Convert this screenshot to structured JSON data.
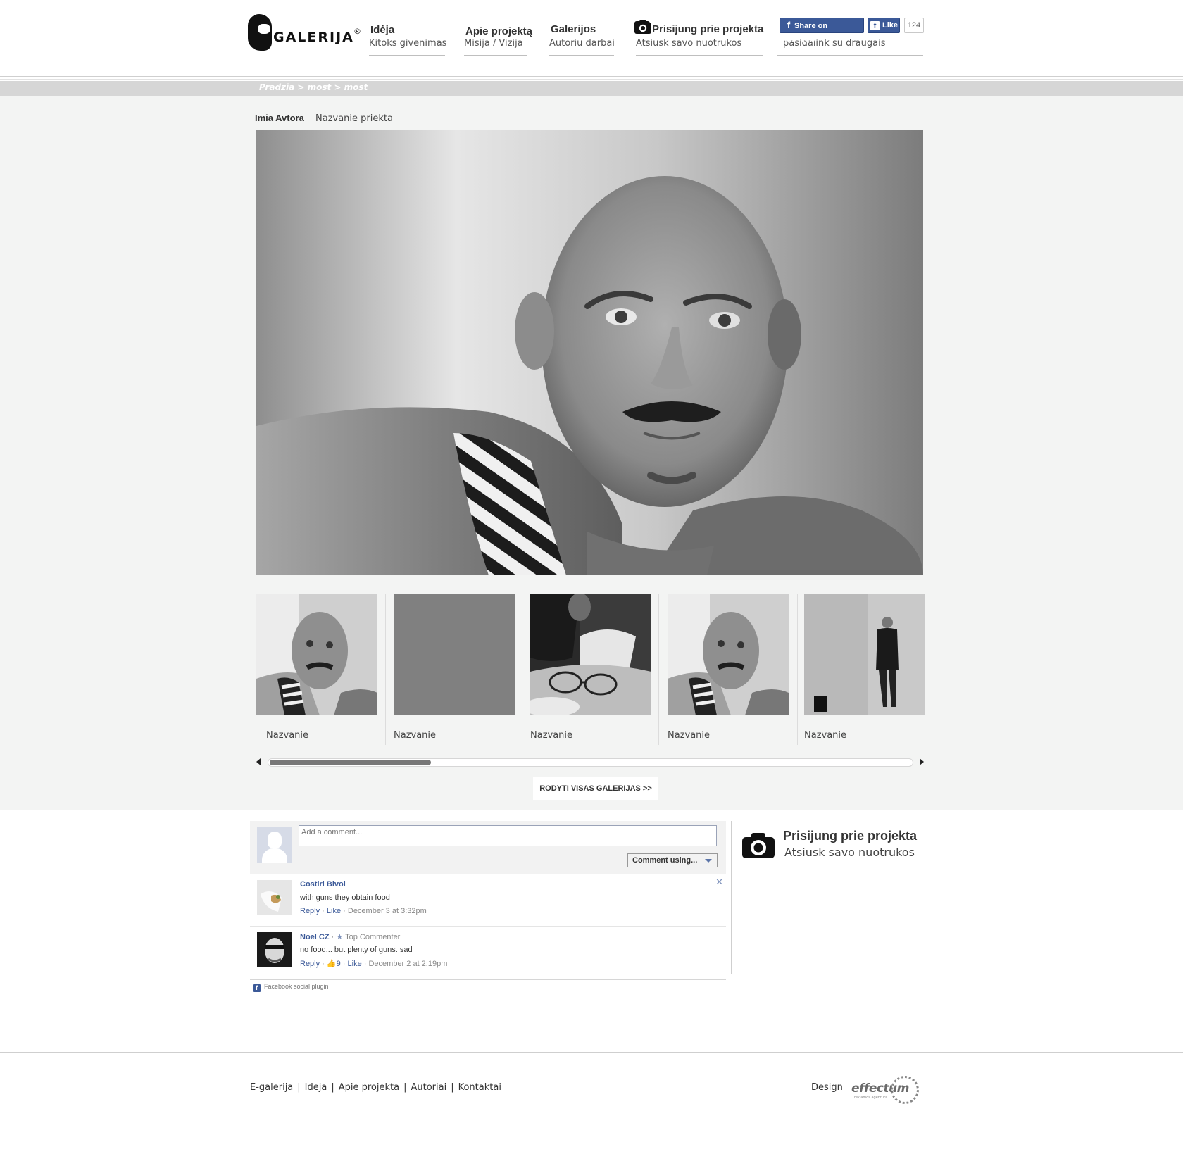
{
  "header": {
    "logo_text": "GALERIJA",
    "logo_mark": "®",
    "nav": [
      {
        "title": "Idėja",
        "sub": "Kitoks givenimas"
      },
      {
        "title": "Apie projektą",
        "sub": "Misija / Vizija"
      },
      {
        "title": "Galerijos",
        "sub": "Autoriu darbai"
      },
      {
        "title": "Prisijung prie projekta",
        "sub": "Atsiusk savo nuotrukos"
      }
    ],
    "share": {
      "share_label": "Share on Facebook",
      "like_label": "Like",
      "like_count": "124",
      "sub": "pasidalink su draugais"
    }
  },
  "breadcrumb": "Pradzia > most > most",
  "photo": {
    "author": "Imia Avtora",
    "project": "Nazvanie priekta"
  },
  "thumbnails": [
    {
      "caption": "Nazvanie",
      "kind": "portrait"
    },
    {
      "caption": "Nazvanie",
      "kind": "blank"
    },
    {
      "caption": "Nazvanie",
      "kind": "glasses"
    },
    {
      "caption": "Nazvanie",
      "kind": "portrait"
    },
    {
      "caption": "Nazvanie",
      "kind": "standing"
    }
  ],
  "scroll": {
    "position": 0.25
  },
  "show_all_label": "RODYTI VISAS GALERIJAS >>",
  "comments_widget": {
    "placeholder": "Add a comment...",
    "comment_using_label": "Comment using...",
    "comments": [
      {
        "author": "Costiri Bivol",
        "badge": "",
        "text": "with guns they obtain food",
        "reply": "Reply",
        "like": "Like",
        "likes_count": "",
        "date": "December 3 at 3:32pm"
      },
      {
        "author": "Noel CZ",
        "badge": "Top Commenter",
        "text": "no food... but plenty of guns. sad",
        "reply": "Reply",
        "like": "Like",
        "likes_count": "9",
        "date": "December 2 at 2:19pm"
      }
    ],
    "plugin_label": "Facebook social plugin"
  },
  "sidebar": {
    "title": "Prisijung prie projekta",
    "sub": "Atsiusk savo nuotrukos"
  },
  "footer": {
    "links": [
      "E-galerija",
      "Ideja",
      "Apie projekta",
      "Autoriai",
      "Kontaktai"
    ],
    "design_label": "Design",
    "design_brand": "effectum",
    "design_tagline": "reklamos agentūra"
  },
  "colors": {
    "facebook_blue": "#3b5998",
    "gallery_bg": "#f3f4f3",
    "crumb_bar": "#d6d6d6"
  }
}
